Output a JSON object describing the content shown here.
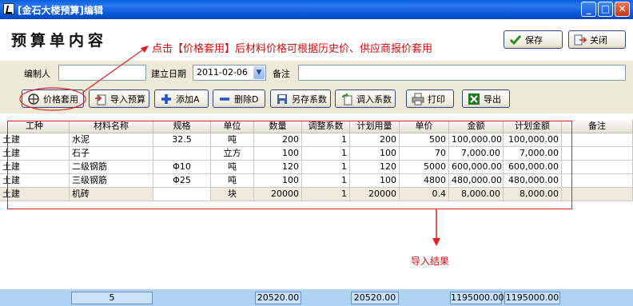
{
  "window": {
    "title": "[金石大楼预算]编辑"
  },
  "page": {
    "title": "预算单内容"
  },
  "annotations": {
    "top": "点击【价格套用】后材料价格可根据历史价、供应商报价套用",
    "bottom": "导入结果"
  },
  "header_buttons": {
    "save": "保存",
    "close": "关闭"
  },
  "form": {
    "editor_label": "编制人",
    "editor_value": "",
    "date_label": "建立日期",
    "date_value": "2011-02-06",
    "remark_label": "备注",
    "remark_value": ""
  },
  "toolbar": {
    "apply_price": "价格套用",
    "import_budget": "导入预算",
    "add": "添加A",
    "delete": "删除D",
    "save_coeff": "另存系数",
    "load_coeff": "调入系数",
    "print": "打印",
    "export": "导出"
  },
  "table": {
    "columns": [
      "工种",
      "材料名称",
      "规格",
      "单位",
      "数量",
      "调整系数",
      "计划用量",
      "单价",
      "金额",
      "计划金额",
      "备注"
    ],
    "rows": [
      [
        "土建",
        "水泥",
        "32.5",
        "吨",
        "200",
        "1",
        "200",
        "500",
        "100,000.00",
        "100,000.00",
        ""
      ],
      [
        "土建",
        "石子",
        "",
        "立方",
        "100",
        "1",
        "100",
        "70",
        "7,000.00",
        "7,000.00",
        ""
      ],
      [
        "土建",
        "二级钢筋",
        "Φ10",
        "吨",
        "120",
        "1",
        "120",
        "5000",
        "600,000.00",
        "600,000.00",
        ""
      ],
      [
        "土建",
        "三级钢筋",
        "Φ25",
        "吨",
        "100",
        "1",
        "100",
        "4800",
        "480,000.00",
        "480,000.00",
        ""
      ],
      [
        "土建",
        "机砖",
        "",
        "块",
        "20000",
        "1",
        "20000",
        "0.4",
        "8,000.00",
        "8,000.00",
        ""
      ]
    ]
  },
  "footer": {
    "count": "5",
    "qty_total": "20520.00",
    "plan_qty_total": "20520.00",
    "amount_total": "1195000.00",
    "plan_amount_total": "1195000.00"
  },
  "colors": {
    "titlebar": "#0a5fe0",
    "annotation": "#d01010",
    "footer": "#aed2f2"
  }
}
